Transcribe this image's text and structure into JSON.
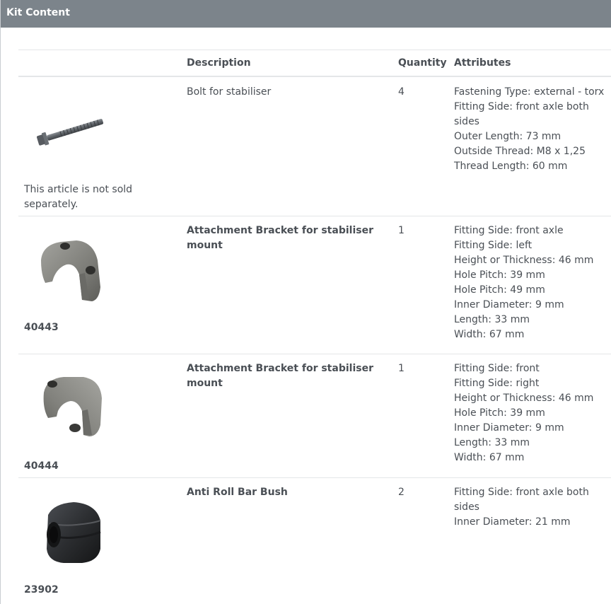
{
  "header": {
    "title": "Kit Content"
  },
  "table": {
    "columns": {
      "image": "",
      "description": "Description",
      "quantity": "Quantity",
      "attributes": "Attributes"
    },
    "rows": [
      {
        "article_no": "",
        "note": "This article is not sold separately.",
        "description": "Bolt for stabiliser",
        "description_bold": false,
        "quantity": "4",
        "image_icon": "bolt-image",
        "attributes": [
          "Fastening Type: external - torx",
          "Fitting Side: front axle both sides",
          "Outer Length: 73 mm",
          "Outside Thread: M8 x 1,25",
          "Thread Length: 60 mm"
        ]
      },
      {
        "article_no": "40443",
        "note": "",
        "description": "Attachment Bracket for stabiliser mount",
        "description_bold": true,
        "quantity": "1",
        "image_icon": "bracket-left-image",
        "attributes": [
          "Fitting Side: front axle",
          "Fitting Side: left",
          "Height or Thickness: 46 mm",
          "Hole Pitch: 39 mm",
          "Hole Pitch: 49 mm",
          "Inner Diameter: 9 mm",
          "Length: 33 mm",
          "Width: 67 mm"
        ]
      },
      {
        "article_no": "40444",
        "note": "",
        "description": "Attachment Bracket for stabiliser mount",
        "description_bold": true,
        "quantity": "1",
        "image_icon": "bracket-right-image",
        "attributes": [
          "Fitting Side: front",
          "Fitting Side: right",
          "Height or Thickness: 46 mm",
          "Hole Pitch: 39 mm",
          "Inner Diameter: 9 mm",
          "Length: 33 mm",
          "Width: 67 mm"
        ]
      },
      {
        "article_no": "23902",
        "note": "",
        "description": "Anti Roll Bar Bush",
        "description_bold": true,
        "quantity": "2",
        "image_icon": "bush-image",
        "attributes": [
          "Fitting Side: front axle both sides",
          "Inner Diameter: 21 mm"
        ]
      }
    ]
  }
}
